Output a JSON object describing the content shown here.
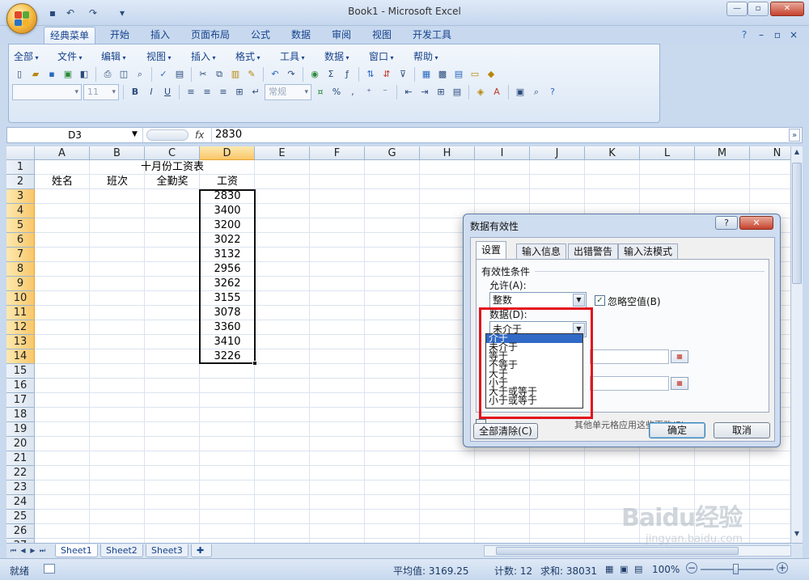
{
  "window": {
    "title": "Book1 - Microsoft Excel",
    "colors": {
      "accent": "#15428b",
      "selected_header": "#f9c76a",
      "highlight_box": "#e3101c"
    }
  },
  "ribbon_tabs": [
    "经典菜单",
    "开始",
    "插入",
    "页面布局",
    "公式",
    "数据",
    "审阅",
    "视图",
    "开发工具"
  ],
  "classic_menu": [
    "全部",
    "文件",
    "编辑",
    "视图",
    "插入",
    "格式",
    "工具",
    "数据",
    "窗口",
    "帮助"
  ],
  "toolbar": {
    "font_size": "11",
    "number_format": "常规"
  },
  "formula_bar": {
    "name_box": "D3",
    "fx": "fx",
    "value": "2830"
  },
  "columns": [
    "A",
    "B",
    "C",
    "D",
    "E",
    "F",
    "G",
    "H",
    "I",
    "J",
    "K",
    "L",
    "M",
    "N"
  ],
  "rows": [
    "1",
    "2",
    "3",
    "4",
    "5",
    "6",
    "7",
    "8",
    "9",
    "10",
    "11",
    "12",
    "13",
    "14",
    "15",
    "16",
    "17",
    "18",
    "19",
    "20",
    "21",
    "22",
    "23",
    "24",
    "25",
    "26",
    "27"
  ],
  "sheet": {
    "title": "十月份工资表",
    "headers": [
      "姓名",
      "班次",
      "全勤奖",
      "工资"
    ],
    "salaries": [
      "2830",
      "3400",
      "3200",
      "3022",
      "3132",
      "2956",
      "3262",
      "3155",
      "3078",
      "3360",
      "3410",
      "3226"
    ]
  },
  "sheet_tabs": [
    "Sheet1",
    "Sheet2",
    "Sheet3"
  ],
  "status": {
    "ready": "就绪",
    "average": "平均值: 3169.25",
    "count": "计数: 12",
    "sum": "求和: 38031",
    "zoom": "100%"
  },
  "dialog": {
    "title": "数据有效性",
    "help": "?",
    "close": "✕",
    "tabs": [
      "设置",
      "输入信息",
      "出错警告",
      "输入法模式"
    ],
    "section": "有效性条件",
    "allow_label": "允许(A):",
    "allow_value": "整数",
    "ignore_blank": "忽略空值(B)",
    "data_label": "数据(D):",
    "data_value": "未介于",
    "options": [
      "介于",
      "未介于",
      "等于",
      "不等于",
      "大于",
      "小于",
      "大于或等于",
      "小于或等于"
    ],
    "apply_text": "对有同样设置的所有其他单元格应用这些更改(P)",
    "apply_visible": "其他单元格应用这些更改(P)",
    "clear_all": "全部清除(C)",
    "ok": "确定",
    "cancel": "取消"
  },
  "watermark": {
    "brand": "Baidu经验",
    "url": "jingyan.baidu.com"
  }
}
